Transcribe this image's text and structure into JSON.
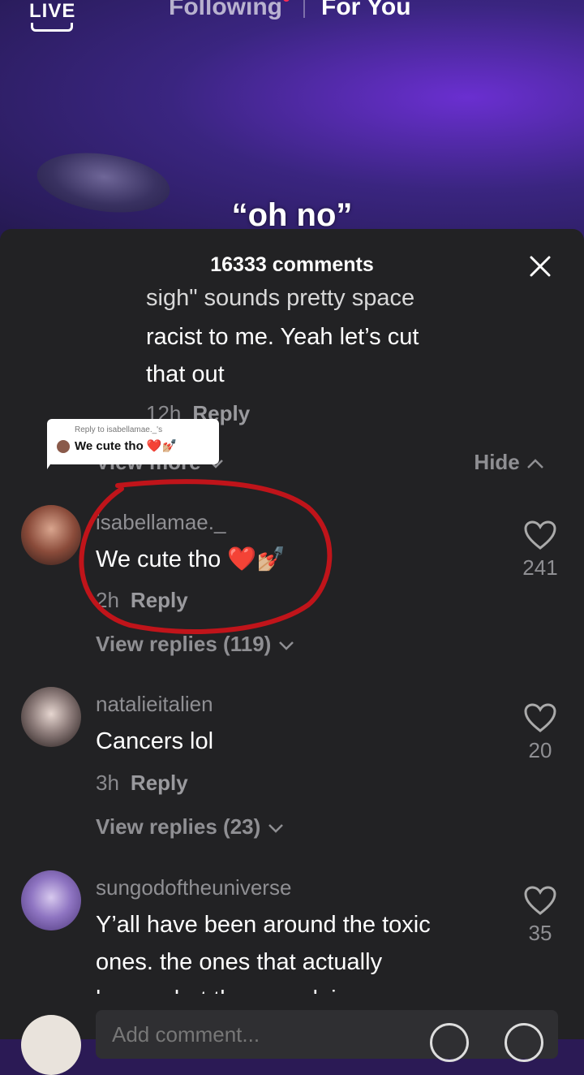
{
  "nav": {
    "live": "LIVE",
    "following": "Following",
    "for_you": "For You"
  },
  "video": {
    "caption": "“oh no”"
  },
  "sheet": {
    "title": "16333 comments"
  },
  "prev_comment": {
    "partial_line": "sigh\" sounds pretty space",
    "line2": "racist to me. Yeah let’s cut",
    "line3": "that out",
    "time": "12h",
    "reply": "Reply",
    "view_more": "View more",
    "hide": "Hide"
  },
  "reply_bubble": {
    "header": "Reply to isabellamae._'s",
    "text": "We cute tho ❤️💅🏼"
  },
  "comments": [
    {
      "username": "isabellamae._",
      "text": "We cute tho ❤️💅🏼",
      "time": "2h",
      "reply": "Reply",
      "likes": "241",
      "view_replies": "View replies (119)"
    },
    {
      "username": "natalieitalien",
      "text": "Cancers lol",
      "time": "3h",
      "reply": "Reply",
      "likes": "20",
      "view_replies": "View replies (23)"
    },
    {
      "username": "sungodoftheuniverse",
      "line1": "Y’all have been around the toxic",
      "line2": "ones. the ones that actually",
      "line3": "know what they are doing are",
      "likes": "35"
    }
  ],
  "input": {
    "placeholder": "Add comment..."
  },
  "colors": {
    "annotation": "#c0141a",
    "accent": "#fe2c55"
  }
}
